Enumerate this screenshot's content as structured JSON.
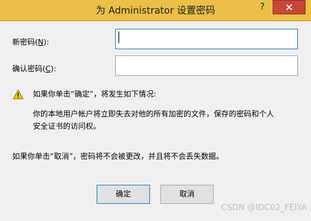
{
  "window": {
    "title": "为 Administrator 设置密码",
    "help_glyph": "?",
    "close_glyph": "✕"
  },
  "form": {
    "new_password_label_prefix": "新密码(",
    "new_password_label_key": "N",
    "new_password_label_suffix": "):",
    "new_password_value": "",
    "confirm_password_label_prefix": "确认密码(",
    "confirm_password_label_key": "C",
    "confirm_password_label_suffix": "):",
    "confirm_password_value": ""
  },
  "warning": {
    "icon": "warning-icon",
    "heading": "如果你单击“确定”，将发生如下情况:",
    "body_line1": "你的本地用户帐户将立即失去对他的所有加密的文件，保存的密码和个人",
    "body_line2": "安全证书的访问权。",
    "cancel_note": "如果你单击“取消”，密码将不会被更改，并且将不会丢失数据。"
  },
  "buttons": {
    "ok_label": "确定",
    "cancel_label": "取消"
  },
  "watermark": "CSDN @IDC02_FEIYA",
  "colors": {
    "titlebar": "#eac048",
    "close_button": "#c7463b",
    "client_bg": "#f0f0f0",
    "warning_yellow": "#f2c80f"
  }
}
